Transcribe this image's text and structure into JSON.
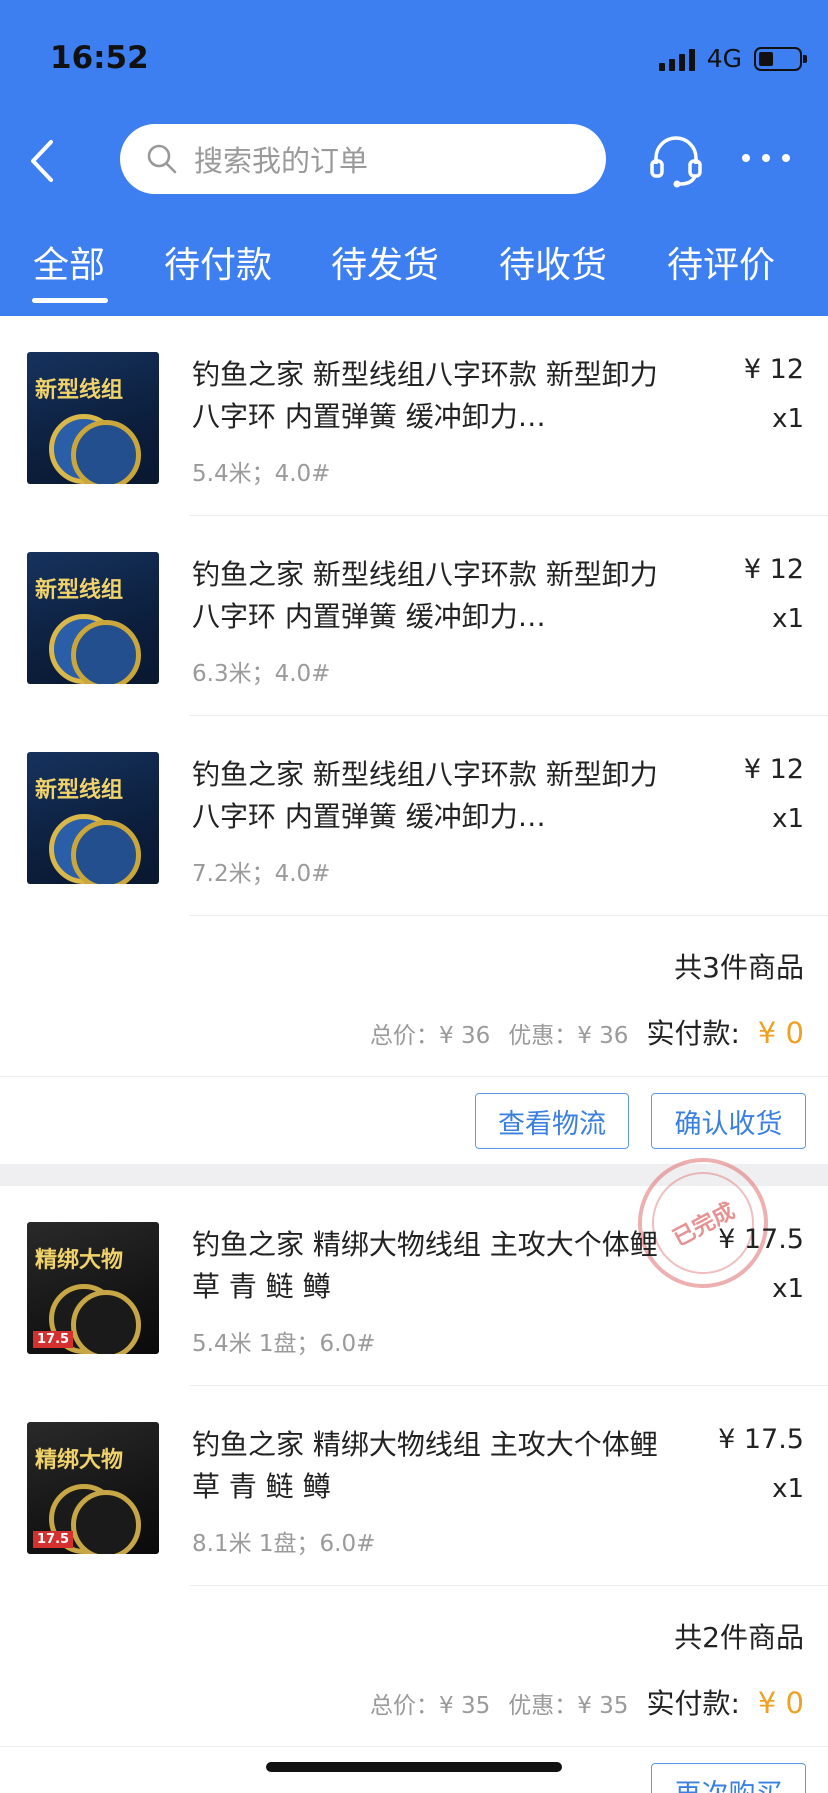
{
  "status": {
    "time": "16:52",
    "network": "4G"
  },
  "header": {
    "search_placeholder": "搜索我的订单",
    "tabs": [
      {
        "label": "全部",
        "active": true
      },
      {
        "label": "待付款",
        "active": false
      },
      {
        "label": "待发货",
        "active": false
      },
      {
        "label": "待收货",
        "active": false
      },
      {
        "label": "待评价",
        "active": false
      }
    ]
  },
  "orders": [
    {
      "items": [
        {
          "title": "钓鱼之家 新型线组八字环款 新型卸力八字环  内置弹簧 缓冲卸力…",
          "spec": "5.4米；4.0#",
          "price": "¥ 12",
          "qty": "x1",
          "thumb_title": "新型线组"
        },
        {
          "title": "钓鱼之家 新型线组八字环款 新型卸力八字环  内置弹簧 缓冲卸力…",
          "spec": "6.3米；4.0#",
          "price": "¥ 12",
          "qty": "x1",
          "thumb_title": "新型线组"
        },
        {
          "title": "钓鱼之家 新型线组八字环款 新型卸力八字环  内置弹簧 缓冲卸力…",
          "spec": "7.2米；4.0#",
          "price": "¥ 12",
          "qty": "x1",
          "thumb_title": "新型线组"
        }
      ],
      "count_text": "共3件商品",
      "total_text": "总价：¥ 36",
      "discount_text": "优惠：¥ 36",
      "paid_label": "实付款:",
      "paid_value": "¥ 0",
      "buttons": [
        "查看物流",
        "确认收货"
      ]
    },
    {
      "stamp": "已完成",
      "items": [
        {
          "title": "钓鱼之家 精绑大物线组  主攻大个体鲤 草 青 鲢 鳟",
          "spec": "5.4米 1盘；6.0#",
          "price": "¥ 17.5",
          "qty": "x1",
          "thumb_title": "精绑大物",
          "thumb_price": "17.5"
        },
        {
          "title": "钓鱼之家 精绑大物线组  主攻大个体鲤 草 青 鲢 鳟",
          "spec": "8.1米 1盘；6.0#",
          "price": "¥ 17.5",
          "qty": "x1",
          "thumb_title": "精绑大物",
          "thumb_price": "17.5"
        }
      ],
      "count_text": "共2件商品",
      "total_text": "总价：¥ 35",
      "discount_text": "优惠：¥ 35",
      "paid_label": "实付款:",
      "paid_value": "¥ 0",
      "buttons": [
        "再次购买"
      ]
    }
  ],
  "colors": {
    "header_bg": "#3d7ef0",
    "accent_orange": "#f0a020",
    "button_blue": "#3b80e0"
  }
}
